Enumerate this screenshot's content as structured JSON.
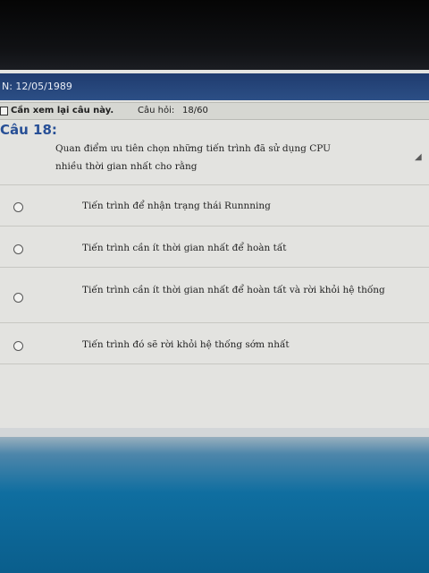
{
  "header": {
    "info_text": "N: 12/05/1989"
  },
  "review": {
    "label": "Cần xem lại câu này.",
    "counter_label": "Câu hỏi:",
    "counter_value": "18/60"
  },
  "question": {
    "title": "Câu 18:",
    "text": "Quan điểm ưu tiên chọn những tiến trình đã sử dụng CPU nhiều thời gian nhất cho rằng"
  },
  "answers": [
    {
      "text": "Tiến trình để nhận trạng thái Runnning"
    },
    {
      "text": "Tiến trình cần ít thời gian nhất để hoàn tất"
    },
    {
      "text": "Tiến trình cần ít thời gian nhất để hoàn tất và rời khỏi hệ thống"
    },
    {
      "text": "Tiến trình đó sẽ rời khỏi hệ thống sớm nhất"
    }
  ],
  "colors": {
    "header_bar": "#2c4f86",
    "question_title": "#274f96",
    "desktop": "#0f6ea0"
  }
}
